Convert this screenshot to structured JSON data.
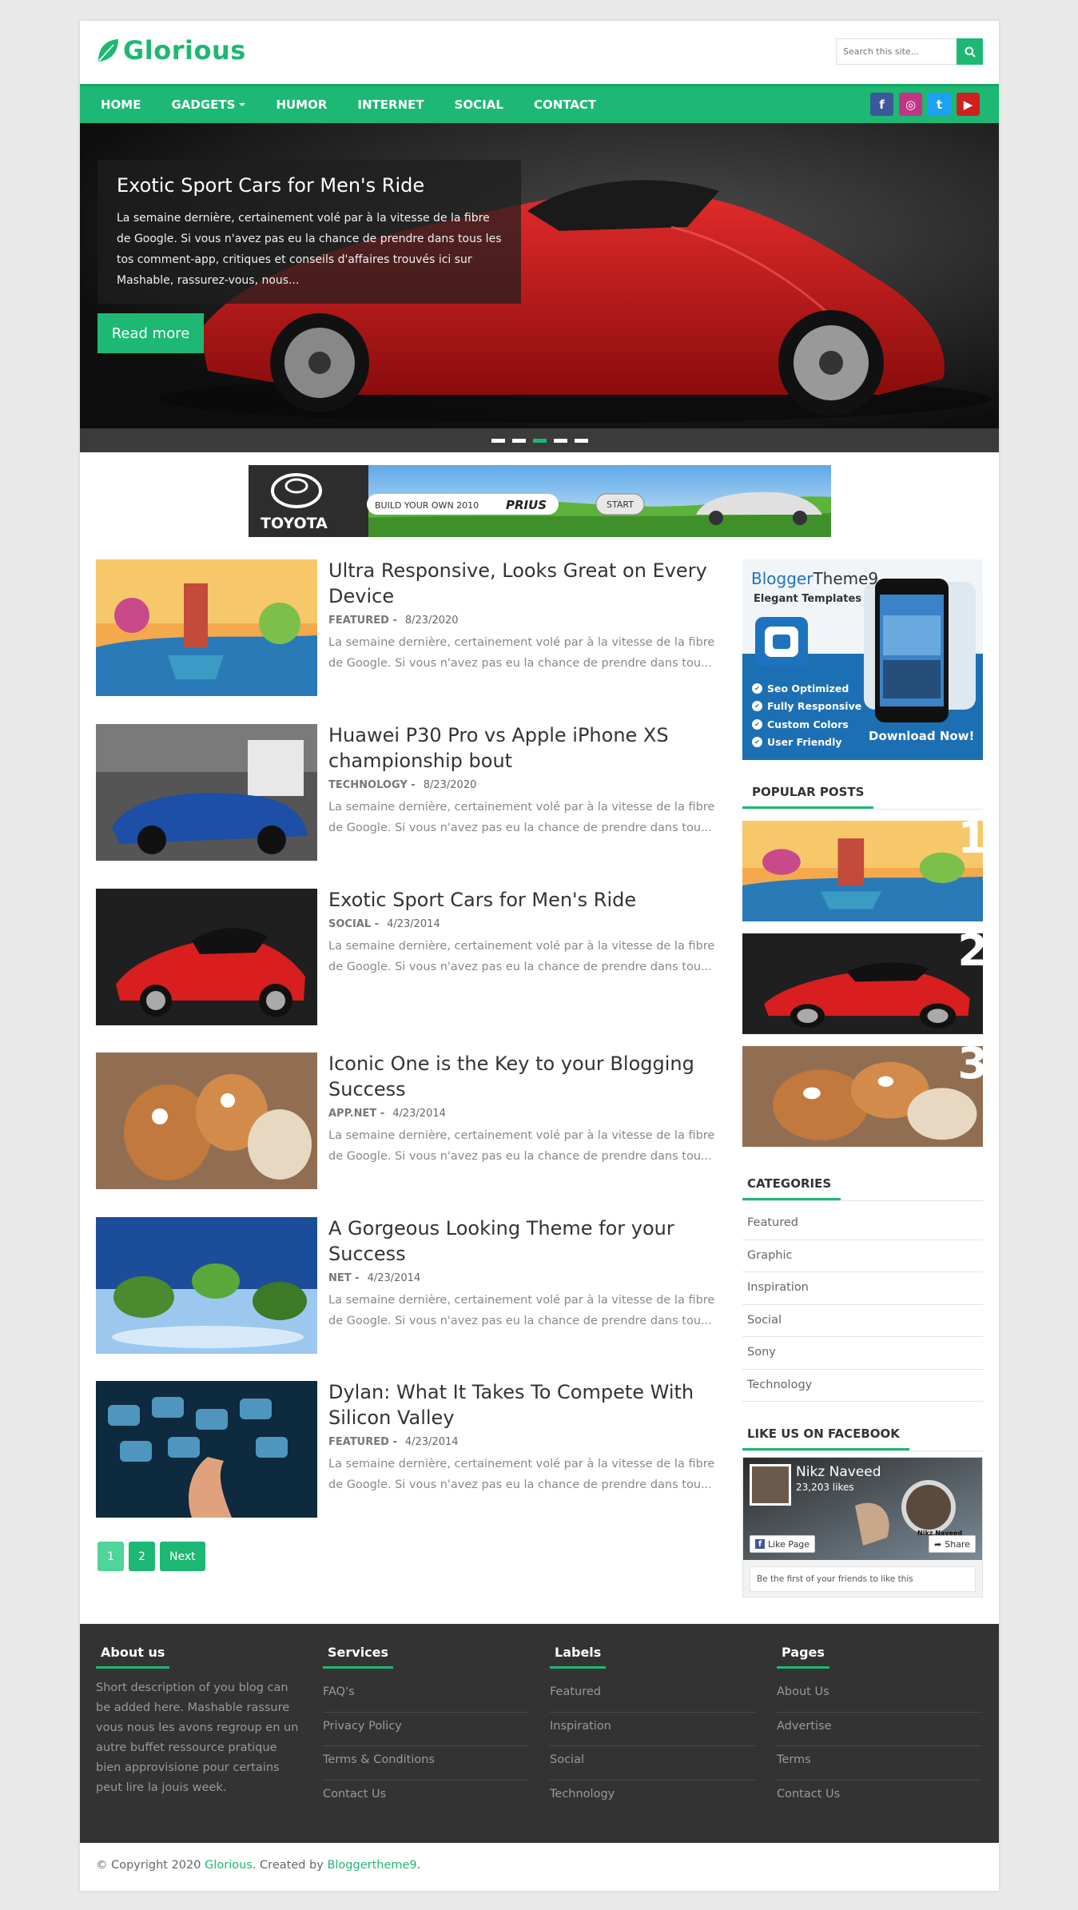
{
  "brand": {
    "name": "Glorious",
    "accent": "#1db874"
  },
  "search": {
    "placeholder": "Search this site..."
  },
  "nav": {
    "items": [
      "HOME",
      "GADGETS",
      "HUMOR",
      "INTERNET",
      "SOCIAL",
      "CONTACT"
    ],
    "socials": [
      {
        "name": "facebook",
        "glyph": "f",
        "color": "#3b5998"
      },
      {
        "name": "instagram",
        "glyph": "◎",
        "color": "#c13584"
      },
      {
        "name": "twitter",
        "glyph": "t",
        "color": "#1da1f2"
      },
      {
        "name": "youtube",
        "glyph": "▶",
        "color": "#cd201f"
      }
    ]
  },
  "slider": {
    "title": "Exotic Sport Cars for Men's Ride",
    "text": "La semaine dernière, certainement volé par à la vitesse de la fibre de Google. Si vous n'avez pas eu la chance de prendre dans tous les tos comment-app, critiques et conseils d'affaires trouvés ici sur Mashable, rassurez-vous, nous...",
    "button": "Read more",
    "dots": 5,
    "active_dot": 2
  },
  "ad": {
    "brand": "TOYOTA",
    "tagline": "BUILD YOUR OWN 2010",
    "model": "PRIUS",
    "button": "START"
  },
  "posts": [
    {
      "title": "Ultra Responsive, Looks Great on Every Device",
      "label": "FEATURED -",
      "date": "8/23/2020",
      "excerpt": "La semaine dernière, certainement volé par à la vitesse de la fibre de Google. Si vous n'avez pas eu la chance de prendre dans tou..."
    },
    {
      "title": "Huawei P30 Pro vs Apple iPhone XS championship bout",
      "label": "TECHNOLOGY -",
      "date": "8/23/2020",
      "excerpt": "La semaine dernière, certainement volé par à la vitesse de la fibre de Google. Si vous n'avez pas eu la chance de prendre dans tou..."
    },
    {
      "title": "Exotic Sport Cars for Men's Ride",
      "label": "SOCIAL -",
      "date": "4/23/2014",
      "excerpt": "La semaine dernière, certainement volé par à la vitesse de la fibre de Google. Si vous n'avez pas eu la chance de prendre dans tou..."
    },
    {
      "title": "Iconic One is the Key to your Blogging Success",
      "label": "APP.NET -",
      "date": "4/23/2014",
      "excerpt": "La semaine dernière, certainement volé par à la vitesse de la fibre de Google. Si vous n'avez pas eu la chance de prendre dans tou..."
    },
    {
      "title": "A Gorgeous Looking Theme for your Success",
      "label": "NET -",
      "date": "4/23/2014",
      "excerpt": "La semaine dernière, certainement volé par à la vitesse de la fibre de Google. Si vous n'avez pas eu la chance de prendre dans tou..."
    },
    {
      "title": "Dylan: What It Takes To Compete With Silicon Valley",
      "label": "FEATURED -",
      "date": "4/23/2014",
      "excerpt": "La semaine dernière, certainement volé par à la vitesse de la fibre de Google. Si vous n'avez pas eu la chance de prendre dans tou..."
    }
  ],
  "pager": {
    "pages": [
      "1",
      "2"
    ],
    "next": "Next"
  },
  "sidebar": {
    "promo": {
      "brand_a": "Blogger",
      "brand_b": "Theme9",
      "sub": "Elegant Templates",
      "features": [
        "Seo Optimized",
        "Fully Responsive",
        "Custom Colors",
        "User Friendly"
      ],
      "cta": "Download Now!"
    },
    "popular_title": "POPULAR POSTS",
    "popular_nums": [
      "1",
      "2",
      "3"
    ],
    "categories_title": "CATEGORIES",
    "categories": [
      "Featured",
      "Graphic",
      "Inspiration",
      "Social",
      "Sony",
      "Technology"
    ],
    "facebook_title": "LIKE US ON FACEBOOK",
    "facebook": {
      "page_name": "Nikz Naveed",
      "likes": "23,203 likes",
      "like_btn": "Like Page",
      "share_btn": "Share",
      "friends": "Be the first of your friends to like this",
      "cover_name": "Nikz Naveed"
    }
  },
  "footer": {
    "about_title": "About us",
    "about_text": "Short description of you blog can be added here. Mashable rassure vous nous les avons regroup en un autre buffet ressource pratique bien approvisione pour certains peut lire la jouis week.",
    "services_title": "Services",
    "services": [
      "FAQ's",
      "Privacy Policy",
      "Terms & Conditions",
      "Contact Us"
    ],
    "labels_title": "Labels",
    "labels": [
      "Featured",
      "Inspiration",
      "Social",
      "Technology"
    ],
    "pages_title": "Pages",
    "pages": [
      "About Us",
      "Advertise",
      "Terms",
      "Contact Us"
    ]
  },
  "copyright": {
    "prefix": "© Copyright 2020",
    "site": "Glorious",
    "middle": ". Created by",
    "creator": "Bloggertheme9",
    "suffix": "."
  }
}
